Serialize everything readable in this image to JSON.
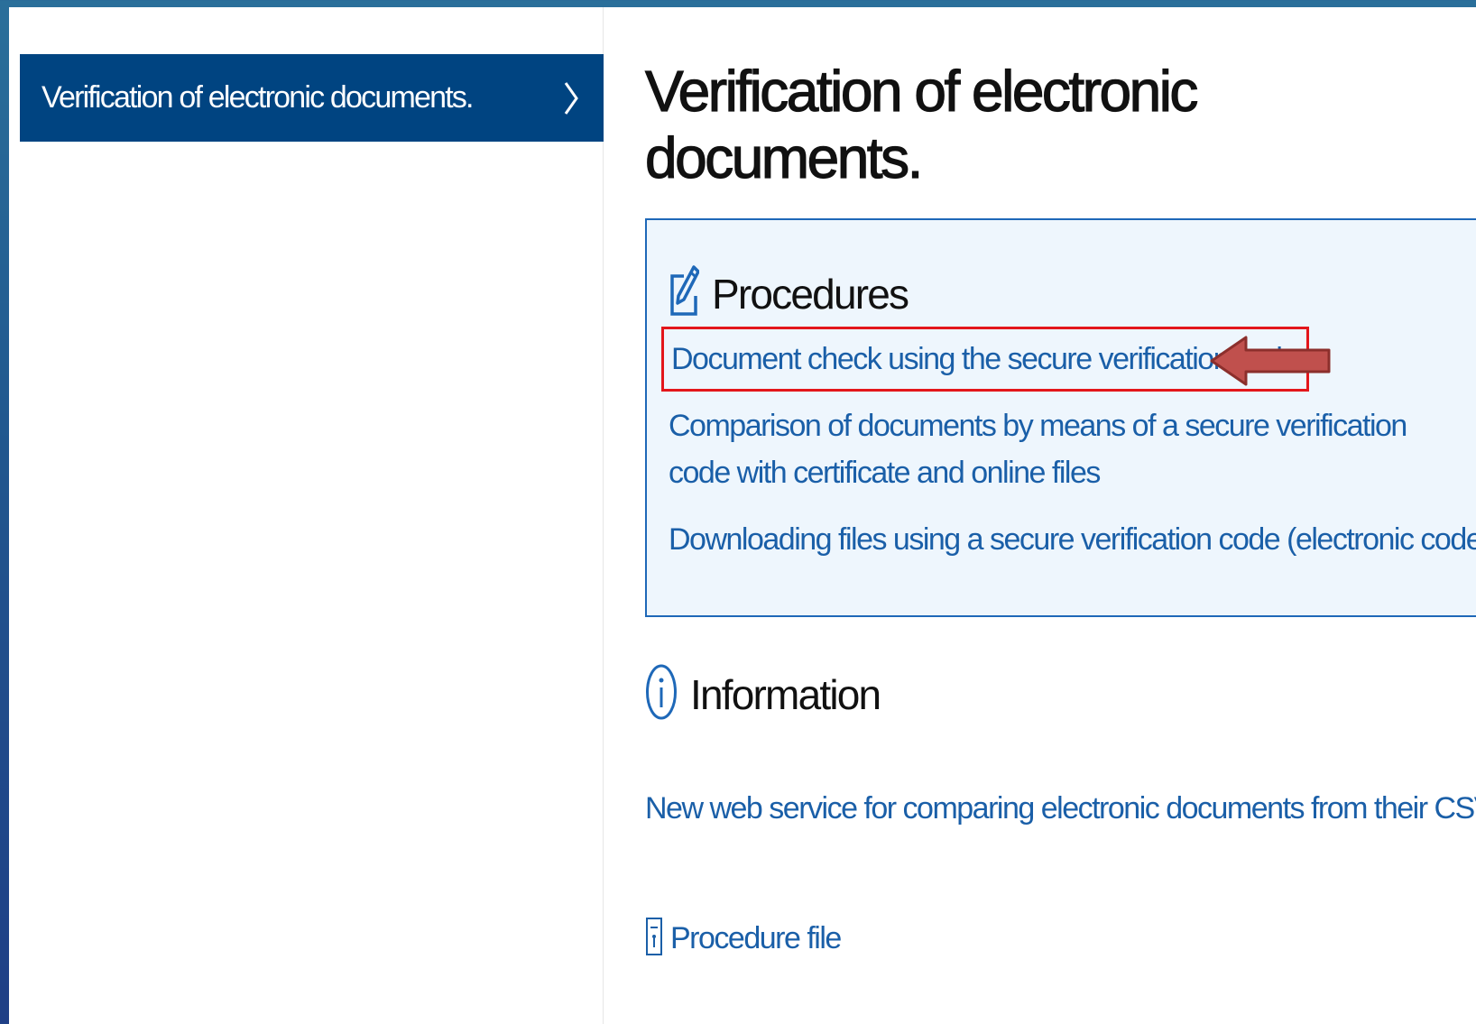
{
  "sidebar": {
    "items": [
      {
        "label": "Verification of electronic documents.",
        "icon": "chevron-right-icon"
      }
    ]
  },
  "main": {
    "title": "Verification of electronic documents.",
    "procedures": {
      "heading": "Procedures",
      "icon": "edit-icon",
      "links": [
        "Document check using the secure verification code",
        "Comparison of documents by means of a secure verification code with certificate and online files",
        "Downloading files using a secure verification code (electronic code)"
      ]
    },
    "information": {
      "heading": "Information",
      "icon": "info-icon",
      "link": "New web service for comparing electronic documents from their CSV"
    },
    "procedure_file": {
      "label": "Procedure file",
      "icon": "document-file-icon"
    }
  },
  "colors": {
    "accent": "#004481",
    "link": "#1a5fa8",
    "highlight": "#e3161b",
    "arrow": "#c0504d",
    "panel": "#eef6fd"
  }
}
